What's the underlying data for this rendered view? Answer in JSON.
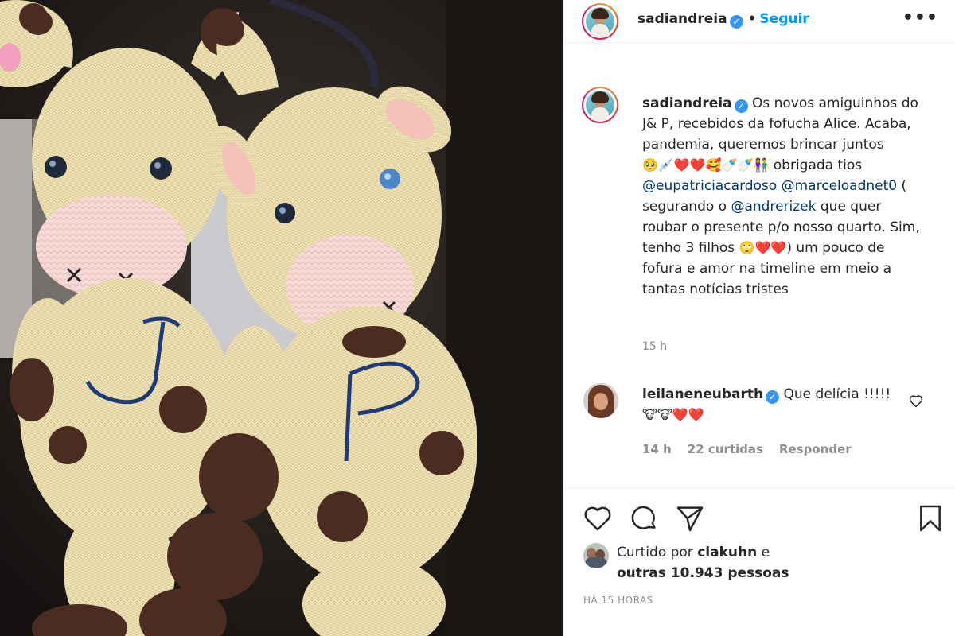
{
  "post": {
    "username": "sadiandreia",
    "follow_label": "Seguir",
    "more_label": "•••",
    "verified_mark": "✓"
  },
  "caption": {
    "username": "sadiandreia",
    "line1": "Os novos amiguinhos do J& P, recebidos da fofucha Alice. Acaba, pandemia, queremos brincar juntos",
    "emojis1": "🥺💉❤️❤️🥰🍼🍼👫",
    "line2": "obrigada tios",
    "mention1": "@eupatriciacardoso",
    "mention2": "@marceloadnet0",
    "line3": "( segurando o",
    "mention3": "@andrerizek",
    "line4": "que quer roubar o presente p/o nosso quarto. Sim, tenho 3 filhos",
    "emojis2": "🙄❤️❤️",
    "line5": ") um pouco de fofura e amor na timeline em meio a tantas notícias tristes",
    "time": "15 h"
  },
  "comment": {
    "username": "leilaneneubarth",
    "text": "Que delícia !!!!!",
    "emojis": "🐮🐮❤️❤️",
    "time": "14 h",
    "likes": "22 curtidas",
    "reply_label": "Responder"
  },
  "likes": {
    "prefix": "Curtido por",
    "user": "clakuhn",
    "conj": "e",
    "others": "outras 10.943 pessoas"
  },
  "post_time": "HÁ 15 HORAS",
  "icons": [
    "heart-icon",
    "comment-icon",
    "share-icon",
    "bookmark-icon",
    "more-icon",
    "verified-icon"
  ],
  "colors": {
    "link": "#0095f6",
    "mention": "#00376b",
    "muted": "#8e8e8e",
    "verified": "#3897f0",
    "heart": "#ed4956"
  }
}
